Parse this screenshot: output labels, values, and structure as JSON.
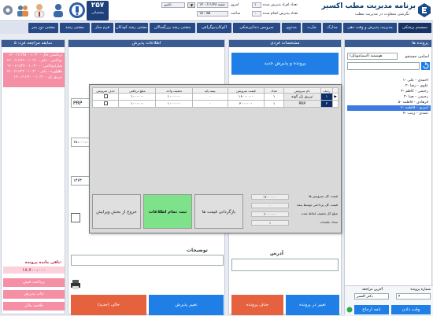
{
  "header": {
    "title": "برنامه مدیریت مطب اکسیر",
    "subtitle": "نگرشی متفاوت در مدیریت مطب",
    "date_label": "امروز",
    "date_value": "۱۴۰۰/۱۱/۲۸ شنبه",
    "time_label": "ساعت",
    "time_value": "۱۵ : ۵۵",
    "admitted_label": "تعداد افراد پذیرش شده",
    "admitted_value": "۱",
    "done_label": "تعداد پذیرش انجام شده",
    "done_value": "۰",
    "support_count": "۲۵۷",
    "support_label": "پشتیبانی",
    "small_btn": "تامین"
  },
  "nav": [
    "سیستم پزشکی",
    "مدیریت پذیرش و وقت دهی",
    "مدارک",
    "چارت",
    "مددوی",
    "سرویس دندانپزشکی",
    "اکوکاردیوگرافی",
    "مشتی رشد بزرگسالان",
    "مشتی رشد کودکان",
    "فرم ساز",
    "مشتی رشد",
    "مشتی دوز سر"
  ],
  "right_panel": {
    "header": "پرونده ها",
    "search_label": "اسامی جستجو",
    "search_value": "هوشمند (اسم/موبایل)",
    "tree": [
      "۱- احمدی - علی",
      "۲- علوی - رضا",
      "۳- رحیمی - کاظم",
      "۴- رحیمی - صبا",
      "۵- فرهادی - فاطمه",
      "۶- امیری - فاطمه",
      "۷- عمدی - زینب"
    ],
    "selected_index": 5,
    "search_btn_label": "جستجو",
    "case_num_label": "شماره پرونده",
    "case_num_value": "۴",
    "last_visit_label": "آخرین مراجعه",
    "last_visit_value": "دکتر اکسیر",
    "btn_bottom1": "وقت دادن",
    "btn_bottom2": "نامه ارجاع"
  },
  "middle_right": {
    "header": "مشخصات فردی",
    "new_case_btn": "پرونده و پذیرش جدید",
    "address_label": "آدرس",
    "btn_change_case": "تغییر در پرونده",
    "btn_delete_case": "حذف پرونده"
  },
  "middle_left": {
    "header": "اطلاعات پذیرش",
    "notes_label": "توضیحات",
    "field_prp": "PRP",
    "field_amount": "۱۸،۰۰۰،۰۰۰",
    "field_qty": "۱۳۶۳",
    "btn_change_admit": "تغییر پذیرش",
    "btn_empty_new": "خالی (جدید)"
  },
  "left_panel": {
    "header": "سابقه مراجعه فرد: ۵",
    "history": [
      "۱۴۰۰/۱۱/۲۸ - ۱۰:۳۰ - برداشتن خال",
      "۱۴۰۰/۱۱/۲۶ - ۱۰:۳۰ - بوتاکس - دکتر",
      "۱۴۰۰/۱۱/۲۴ - ۱۰:۳۰ - فیلر/بوتاکس - دکتر",
      "۱۴۰۰/۱۱/۲۲ - ۱۰:۳۰ - مشاوره - دکتر",
      "۱۴۰۰/۱۱/۲۰ - ۱۰:۳۰ - تزریق ژل"
    ],
    "remaining_label": "باقی مانده پرونده:",
    "remaining_value": "۱۸،۷۰۰،۰۰۰",
    "btn1": "پرداخت فیش",
    "btn2": "چاپ پذیرش",
    "btn3": "خلاصه مالی"
  },
  "dialog": {
    "columns": [
      "ردیف",
      "نام سرویس",
      "تعداد",
      "قیمت سرویس",
      "بیمه پایه",
      "تخفیف واحد",
      "مبلغ دریافتی",
      "حذف سرویس"
    ],
    "rows": [
      [
        "۱",
        "تزریق ژل گونه",
        "۱",
        "۱۶۰۰۰۰۰۰",
        "۰",
        "۱۰۰۰۰۰۰",
        "۱۰۰۰۰۰۰",
        ""
      ],
      [
        "۲",
        "PRP",
        "۱",
        "۲۰۰۰۰۰۰",
        "۰",
        "۱۰۰۰۰۰۰",
        "۱۰۰۰۰۰۰",
        ""
      ]
    ],
    "summary": [
      {
        "label": "قیمت کل سرویس ها",
        "value": "۱۷۰۰۰۰۰۰"
      },
      {
        "label": "قیمت کل پرداختی توسط بیمه",
        "value": "۰"
      },
      {
        "label": "مبلغ کل تخفیف لحاظ شده",
        "value": "۲۰۰۰۰۰۰"
      },
      {
        "label": "تعداد جلسات",
        "value": "۱"
      }
    ],
    "btn_reset": "بازگردانی قیمت ها",
    "btn_save": "ثبت تمام اطلاعات",
    "btn_exit": "خروج از بخش ویرایش"
  },
  "colors": {
    "nav": "#274a86",
    "accent_blue": "#1f7fe6",
    "save_green": "#7ee28a",
    "danger": "#e6623e",
    "history": "#f58fa5"
  }
}
